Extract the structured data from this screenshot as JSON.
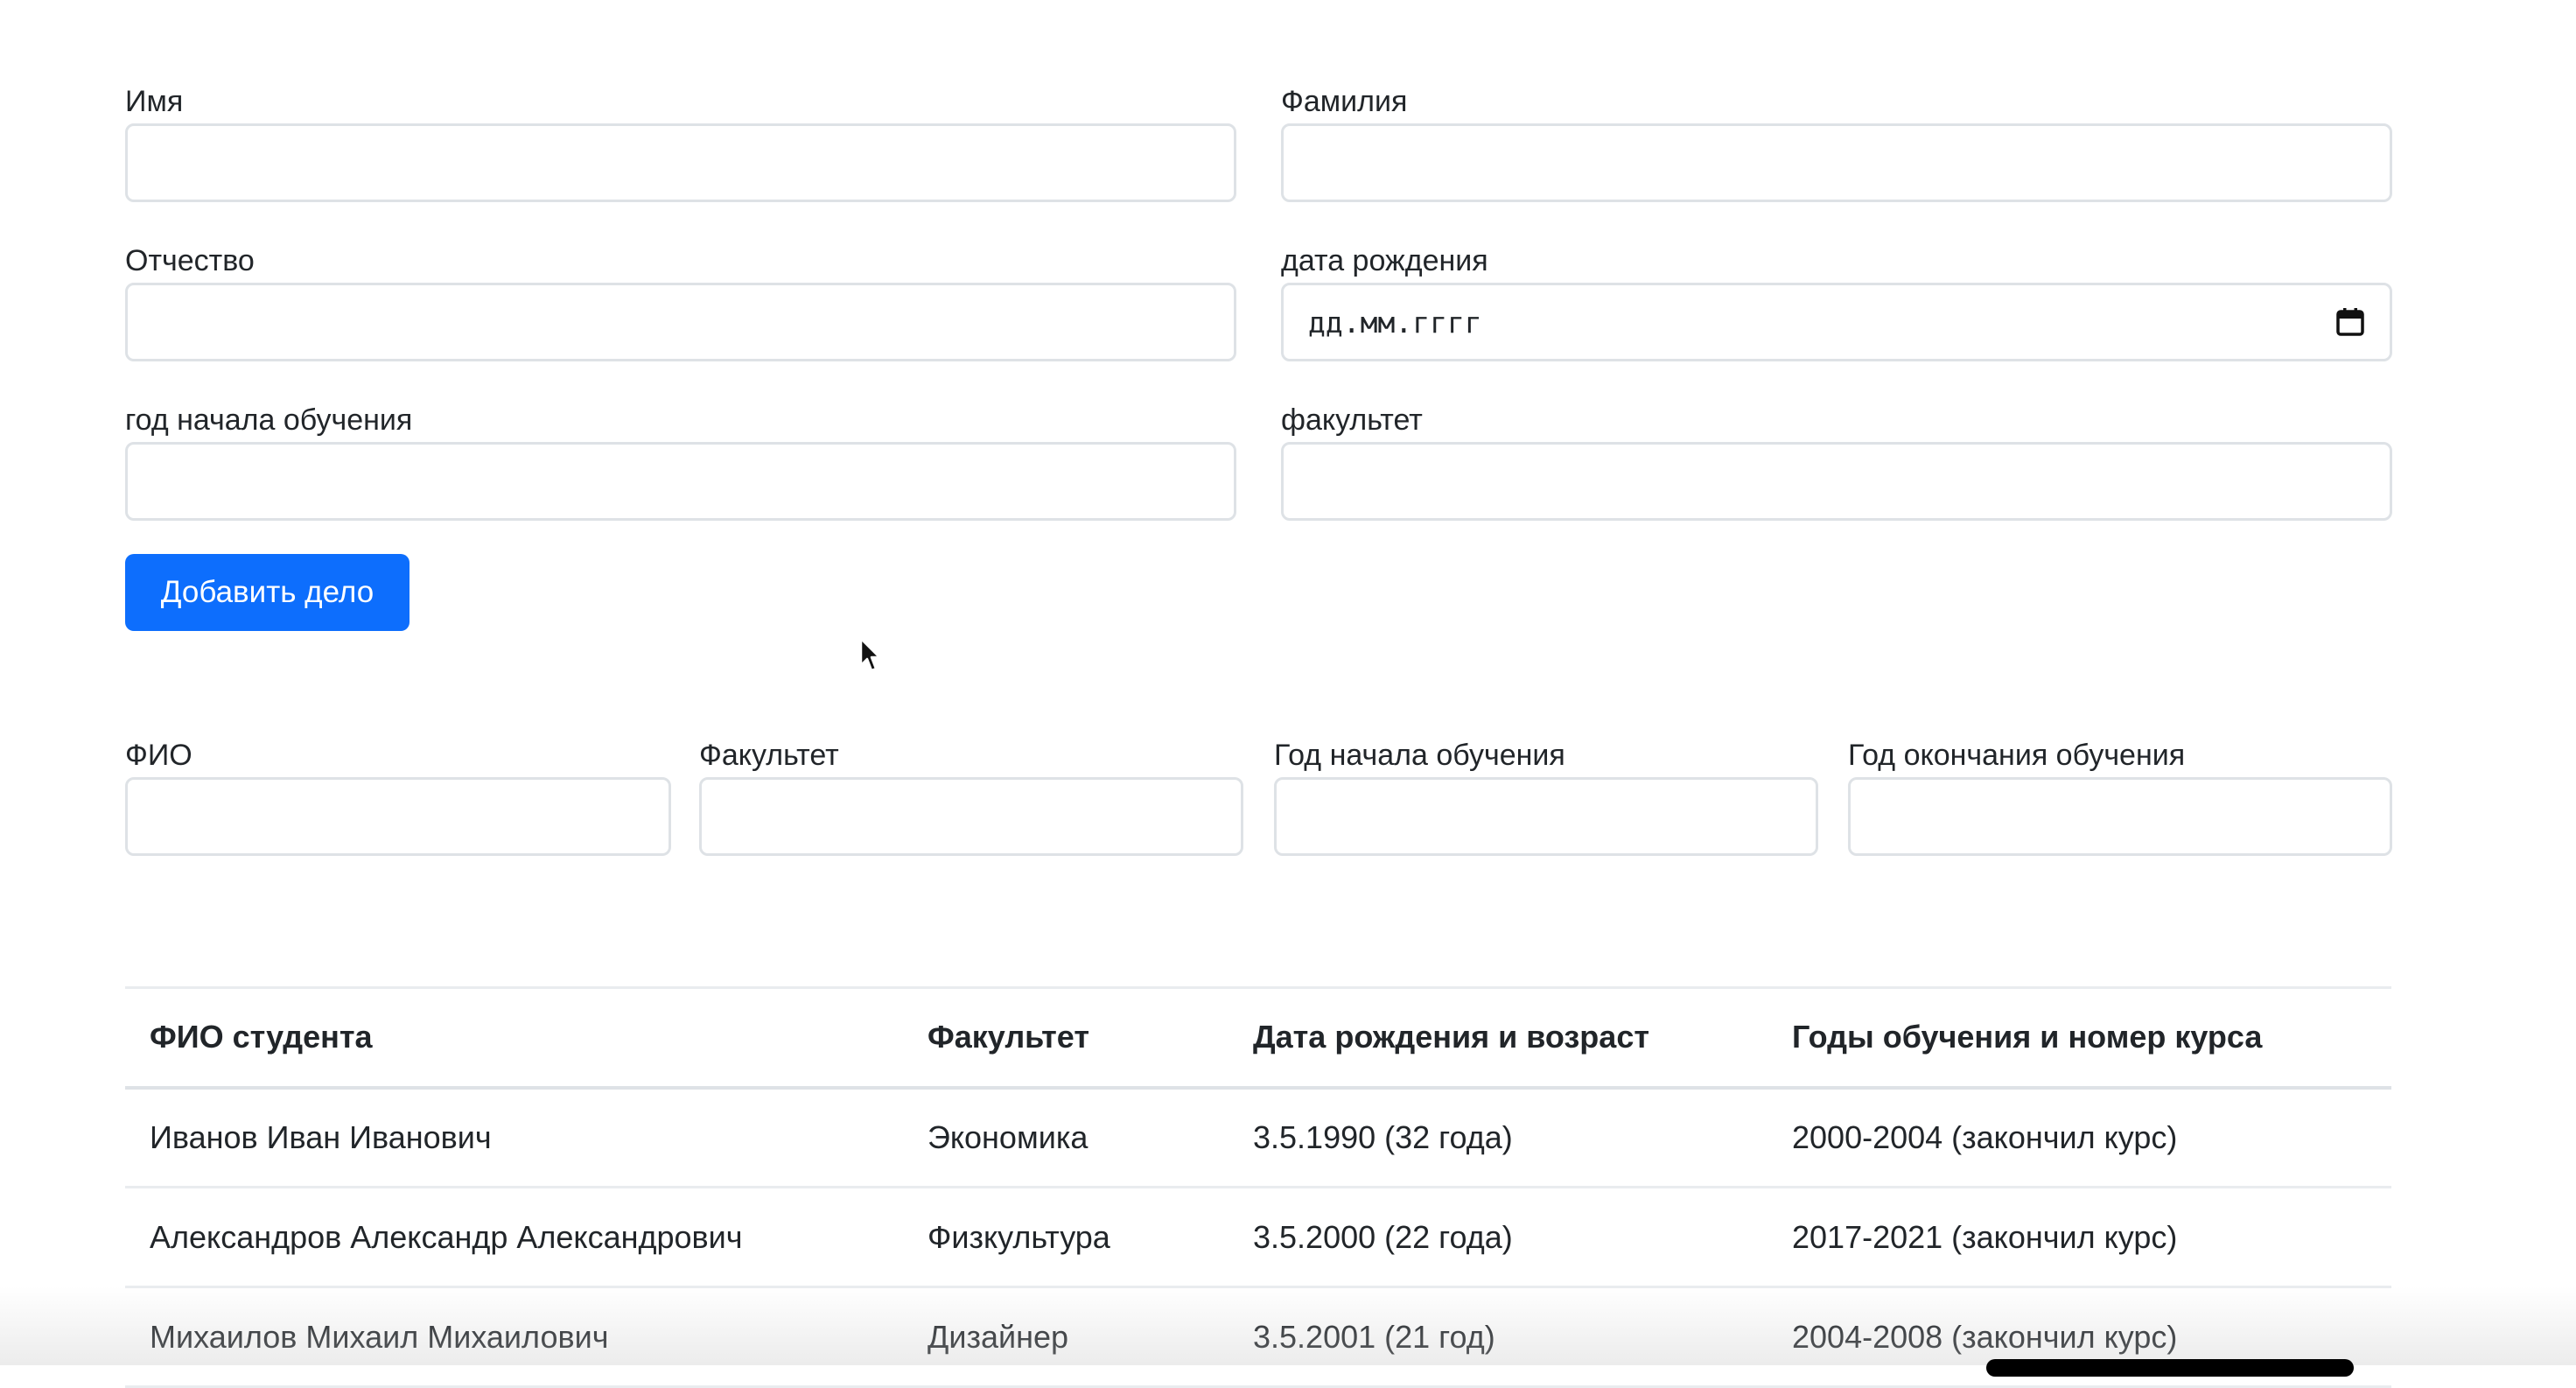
{
  "form": {
    "first_name_label": "Имя",
    "last_name_label": "Фамилия",
    "patronymic_label": "Отчество",
    "birth_date_label": "дата рождения",
    "birth_date_placeholder": "дд.мм.гггг",
    "start_year_label": "год начала обучения",
    "faculty_label": "факультет",
    "submit_label": "Добавить дело"
  },
  "filters": {
    "fio_label": "ФИО",
    "faculty_label": "Факультет",
    "start_year_label": "Год начала обучения",
    "end_year_label": "Год окончания обучения"
  },
  "table": {
    "headers": [
      "ФИО студента",
      "Факультет",
      "Дата рождения и возраст",
      "Годы обучения и номер курса"
    ],
    "rows": [
      [
        "Иванов Иван Иванович",
        "Экономика",
        "3.5.1990 (32 года)",
        "2000-2004 (закончил курс)"
      ],
      [
        "Александров Александр Александрович",
        "Физкультура",
        "3.5.2000 (22 года)",
        "2017-2021 (закончил курс)"
      ],
      [
        "Михаилов Михаил Михаилович",
        "Дизайнер",
        "3.5.2001 (21 год)",
        "2004-2008 (закончил курс)"
      ]
    ]
  },
  "icons": {
    "calendar": "calendar-icon",
    "cursor": "mouse-pointer-icon"
  },
  "colors": {
    "primary": "#0d6efd",
    "border": "#dee2e6",
    "text": "#212529"
  }
}
